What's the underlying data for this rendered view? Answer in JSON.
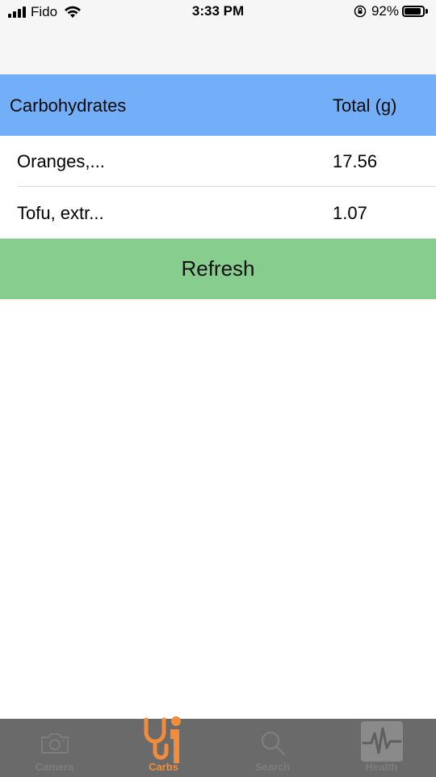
{
  "status_bar": {
    "carrier": "Fido",
    "time": "3:33 PM",
    "battery_percent": "92%",
    "battery_level": 0.92
  },
  "table": {
    "headers": {
      "name": "Carbohydrates",
      "total": "Total (g)"
    },
    "rows": [
      {
        "name": "Oranges,...",
        "total": "17.56"
      },
      {
        "name": "Tofu, extr...",
        "total": "1.07"
      }
    ]
  },
  "refresh_button": {
    "label": "Refresh"
  },
  "tab_bar": {
    "active_color": "#f08c3a",
    "inactive_color": "#7d7d7d",
    "tabs": [
      {
        "label": "Camera",
        "icon": "camera-icon"
      },
      {
        "label": "Carbs",
        "icon": "stethoscope-icon",
        "active": true
      },
      {
        "label": "Search",
        "icon": "search-icon"
      },
      {
        "label": "Health",
        "icon": "heart-monitor-icon"
      }
    ]
  },
  "colors": {
    "header_bg": "#73aff8",
    "refresh_bg": "#87cd8e"
  }
}
